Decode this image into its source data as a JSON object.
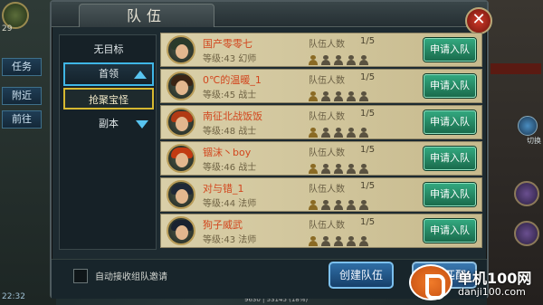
{
  "hud": {
    "level": "29",
    "tabs": [
      "任务",
      "附近",
      "前往"
    ],
    "time": "22:32",
    "coords": "9630 | 53145 (18%)",
    "right_label": "切换"
  },
  "dialog": {
    "title": "队伍",
    "close_label": "✕"
  },
  "sidebar": {
    "items": [
      {
        "label": "无目标"
      },
      {
        "label": "首领"
      },
      {
        "label": "抢聚宝怪"
      },
      {
        "label": "副本"
      }
    ]
  },
  "teams": [
    {
      "name": "国产零零七",
      "info": "等级:43 幻师",
      "members_label": "队伍人数",
      "members": "1/5",
      "filled": 1,
      "apply": "申请入队",
      "hair": "#2a3a2a"
    },
    {
      "name": "0℃的温暖_1",
      "info": "等级:45 战士",
      "members_label": "队伍人数",
      "members": "1/5",
      "filled": 1,
      "apply": "申请入队",
      "hair": "#3a2414"
    },
    {
      "name": "南征北战饭饭",
      "info": "等级:48 战士",
      "members_label": "队伍人数",
      "members": "1/5",
      "filled": 1,
      "apply": "申请入队",
      "hair": "#b13a14"
    },
    {
      "name": "锢沫丶boy",
      "info": "等级:46 战士",
      "members_label": "队伍人数",
      "members": "1/5",
      "filled": 1,
      "apply": "申请入队",
      "hair": "#c23a12"
    },
    {
      "name": "对与错_1",
      "info": "等级:44 法师",
      "members_label": "队伍人数",
      "members": "1/5",
      "filled": 1,
      "apply": "申请入队",
      "hair": "#1f2836"
    },
    {
      "name": "狗子威武",
      "info": "等级:43 法师",
      "members_label": "队伍人数",
      "members": "1/5",
      "filled": 1,
      "apply": "申请入队",
      "hair": "#1a2230"
    }
  ],
  "bottom": {
    "auto_accept_label": "自动接收组队邀请",
    "create_label": "创建队伍",
    "auto_match_label": "自动匹配"
  },
  "watermark": {
    "name": "单机100网",
    "url": "danji100.com"
  }
}
